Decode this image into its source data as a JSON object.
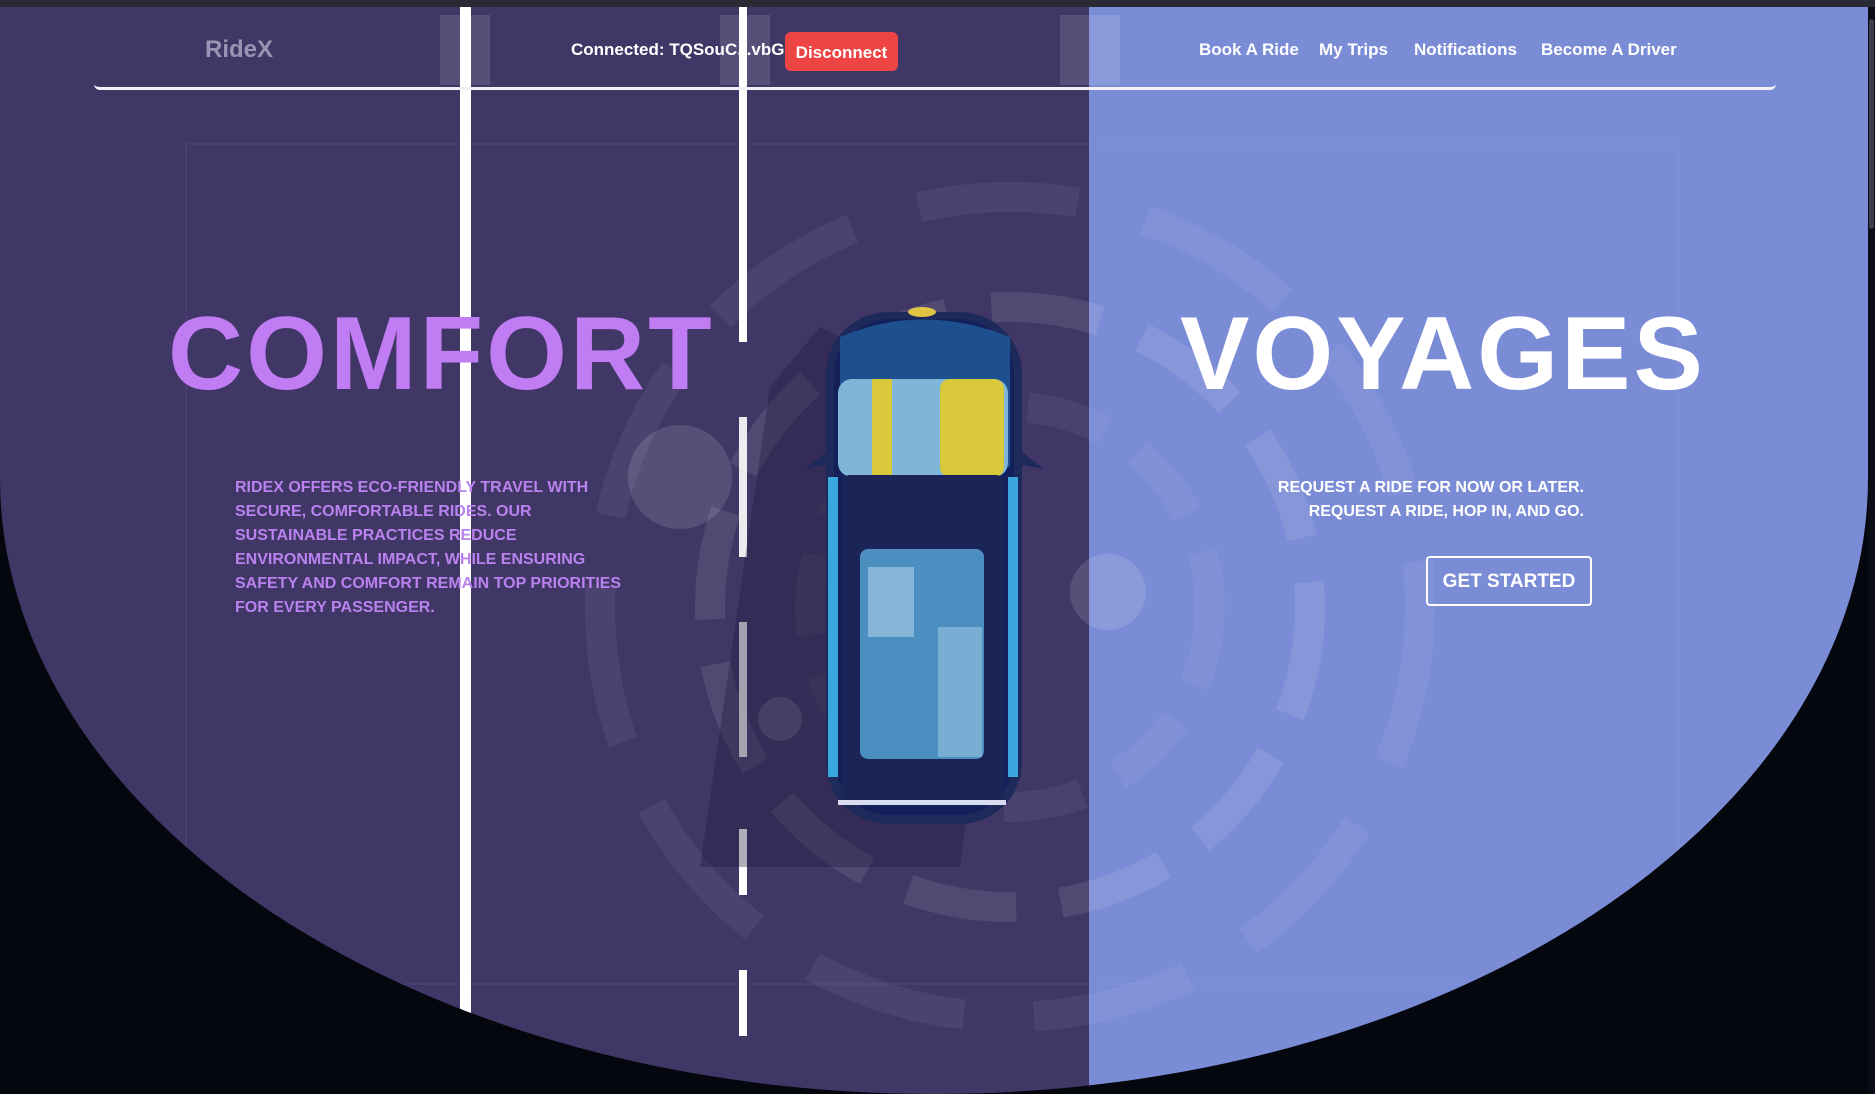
{
  "navbar": {
    "brand": "RideX",
    "wallet_status": "Connected: TQSouC...vbGY",
    "disconnect_label": "Disconnect",
    "links": [
      {
        "label": "Book A Ride"
      },
      {
        "label": "My Trips"
      },
      {
        "label": "Notifications"
      },
      {
        "label": "Become A Driver"
      }
    ]
  },
  "hero": {
    "left_title": "COMFORT",
    "right_title": "VOYAGES",
    "left_description": "RIDEX OFFERS ECO-FRIENDLY TRAVEL WITH SECURE, COMFORTABLE RIDES. OUR SUSTAINABLE PRACTICES REDUCE ENVIRONMENTAL IMPACT, WHILE ENSURING SAFETY AND COMFORT REMAIN TOP PRIORITIES FOR EVERY PASSENGER.",
    "right_line_1": "REQUEST A RIDE FOR NOW OR LATER.",
    "right_line_2": "REQUEST A RIDE, HOP IN, AND GO.",
    "cta_label": "GET STARTED"
  },
  "colors": {
    "left_panel": "#413766",
    "right_panel": "#7b8cd6",
    "accent_purple": "#c07cf3",
    "disconnect_red": "#ef4444",
    "page_background": "#05070f"
  },
  "icons": {
    "hero_illustration": "car-top-view-on-road"
  }
}
